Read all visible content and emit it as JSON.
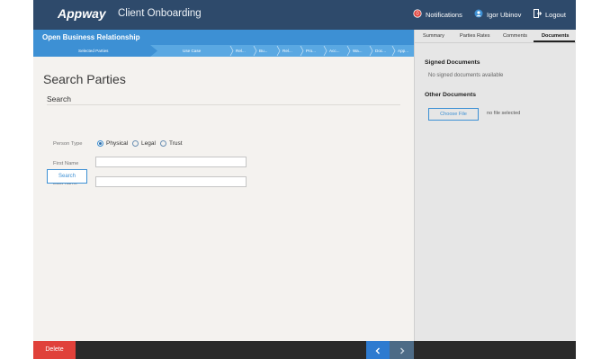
{
  "header": {
    "logo": "Appway",
    "app_title": "Client Onboarding",
    "notifications_label": "Notifications",
    "user_name": "Igor Ubinov",
    "logout_label": "Logout"
  },
  "process": {
    "title": "Open Business Relationship",
    "steps": [
      "Selected Parties",
      "Use Case",
      "Rel...",
      "Bu...",
      "Rel...",
      "Pro...",
      "Acc...",
      "Wa...",
      "Doc...",
      "App..."
    ],
    "active_step_index": 0
  },
  "search": {
    "page_title": "Search Parties",
    "section_title": "Search",
    "person_type_label": "Person Type",
    "person_types": [
      "Physical",
      "Legal",
      "Trust"
    ],
    "selected_person_type": "Physical",
    "first_name_label": "First Name",
    "first_name_value": "",
    "last_name_label": "Last name",
    "last_name_value": "",
    "search_button": "Search"
  },
  "right_panel": {
    "tabs": [
      "Summary",
      "Parties Rates",
      "Comments",
      "Documents"
    ],
    "active_tab": "Documents",
    "signed_heading": "Signed Documents",
    "no_signed": "No signed documents available",
    "other_heading": "Other Documents",
    "choose_file": "Choose File",
    "no_file": "no file selected"
  },
  "footer": {
    "delete_label": "Delete",
    "prev_icon": "chevron-left-icon",
    "next_icon": "chevron-right-icon"
  },
  "colors": {
    "header_bg": "#2e4a6b",
    "accent": "#3d90d4",
    "delete": "#e0413a"
  }
}
